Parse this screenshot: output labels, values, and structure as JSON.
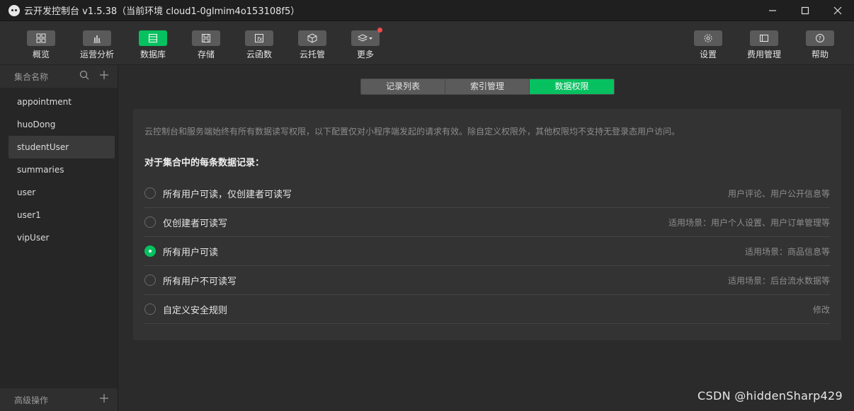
{
  "window": {
    "title": "云开发控制台 v1.5.38（当前环境 cloud1-0glmim4o153108f5）"
  },
  "toolbar": {
    "left": [
      {
        "label": "概览",
        "icon": "grid-icon"
      },
      {
        "label": "运营分析",
        "icon": "bar-chart-icon"
      },
      {
        "label": "数据库",
        "icon": "database-icon",
        "active": true
      },
      {
        "label": "存储",
        "icon": "save-icon"
      },
      {
        "label": "云函数",
        "icon": "function-icon"
      },
      {
        "label": "云托管",
        "icon": "cube-icon"
      },
      {
        "label": "更多",
        "icon": "layers-icon",
        "badge": true
      }
    ],
    "right": [
      {
        "label": "设置",
        "icon": "gear-icon"
      },
      {
        "label": "费用管理",
        "icon": "billing-icon"
      },
      {
        "label": "帮助",
        "icon": "help-icon"
      }
    ]
  },
  "sidebar": {
    "header": "集合名称",
    "collections": [
      "appointment",
      "huoDong",
      "studentUser",
      "summaries",
      "user",
      "user1",
      "vipUser"
    ],
    "selected": "studentUser",
    "footer": "高级操作"
  },
  "tabs": [
    {
      "label": "记录列表"
    },
    {
      "label": "索引管理"
    },
    {
      "label": "数据权限",
      "active": true
    }
  ],
  "permissions": {
    "notice": "云控制台和服务端始终有所有数据读写权限，以下配置仅对小程序端发起的请求有效。除自定义权限外，其他权限均不支持无登录态用户访问。",
    "section_title": "对于集合中的每条数据记录：",
    "options": [
      {
        "label": "所有用户可读，仅创建者可读写",
        "hint": "用户评论、用户公开信息等",
        "checked": false
      },
      {
        "label": "仅创建者可读写",
        "hint": "适用场景：用户个人设置、用户订单管理等",
        "checked": false
      },
      {
        "label": "所有用户可读",
        "hint": "适用场景：商品信息等",
        "checked": true
      },
      {
        "label": "所有用户不可读写",
        "hint": "适用场景：后台流水数据等",
        "checked": false
      },
      {
        "label": "自定义安全规则",
        "hint": "修改",
        "checked": false
      }
    ]
  },
  "watermark": "CSDN @hiddenSharp429",
  "colors": {
    "accent": "#07c160",
    "badge": "#f04a4a"
  }
}
